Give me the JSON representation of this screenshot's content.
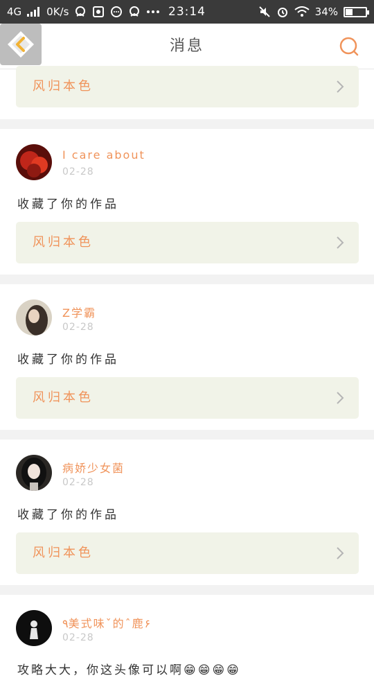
{
  "status_bar": {
    "network": "4G",
    "speed": "0K/s",
    "time": "23:14",
    "battery": "34%",
    "battery_fraction": 0.34
  },
  "header": {
    "title": "消息",
    "back_icon": "diamond-back-icon",
    "search_icon": "search-icon"
  },
  "top_card": {
    "notice_label": "风归本色"
  },
  "messages": [
    {
      "username": "I care about",
      "date": "02-28",
      "text": "收藏了你的作品",
      "notice_label": "风归本色"
    },
    {
      "username": "Z学霸",
      "date": "02-28",
      "text": "收藏了你的作品",
      "notice_label": "风归本色"
    },
    {
      "username": "病娇少女菌",
      "date": "02-28",
      "text": "收藏了你的作品",
      "notice_label": "风归本色"
    },
    {
      "username": "۹美式味ˇ的ˆ鹿۶",
      "date": "02-28",
      "text": "攻略大大，你这头像可以啊😁😁😁😁"
    }
  ],
  "colors": {
    "accent": "#f0935a",
    "notice_bg": "#f1f3e8",
    "status_bar": "#3a3a3a"
  }
}
